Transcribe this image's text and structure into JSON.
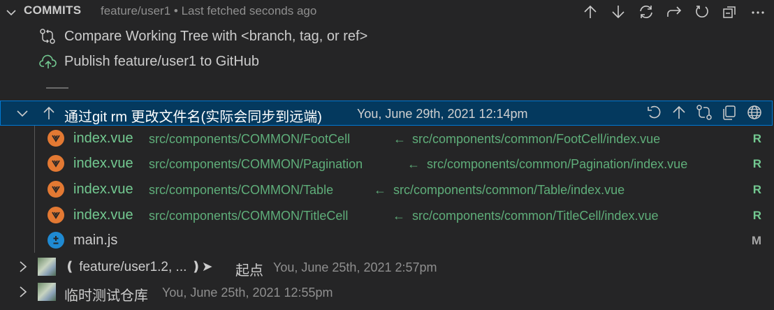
{
  "header": {
    "title": "COMMITS",
    "description": "feature/user1 • Last fetched seconds ago",
    "actions": [
      "arrow-up-icon",
      "arrow-down-icon",
      "sync-icon",
      "redo-icon",
      "refresh-icon",
      "collapse-all-icon",
      "more-icon"
    ]
  },
  "actions": {
    "compare": "Compare Working Tree with <branch, tag, or ref>",
    "publish": "Publish feature/user1 to GitHub"
  },
  "commit": {
    "message": "通过git rm 更改文件名(实际会同步到远端)",
    "meta": "You, June 29th, 2021 12:14pm",
    "actions": [
      "undo-icon",
      "arrow-up-icon",
      "compare-icon",
      "copy-icon",
      "globe-icon"
    ],
    "files": [
      {
        "name": "index.vue",
        "path": "src/components/COMMON/FootCell",
        "arrow": "←",
        "from": "src/components/common/FootCell/index.vue",
        "status": "R"
      },
      {
        "name": "index.vue",
        "path": "src/components/COMMON/Pagination",
        "arrow": "←",
        "from": "src/components/common/Pagination/index.vue",
        "status": "R"
      },
      {
        "name": "index.vue",
        "path": "src/components/COMMON/Table",
        "arrow": "←",
        "from": "src/components/common/Table/index.vue",
        "status": "R"
      },
      {
        "name": "index.vue",
        "path": "src/components/COMMON/TitleCell",
        "arrow": "←",
        "from": "src/components/common/TitleCell/index.vue",
        "status": "R"
      },
      {
        "name": "main.js",
        "status": "M"
      }
    ]
  },
  "other_commits": [
    {
      "refs": "❪ feature/user1.2, ... ❫➤",
      "message": "起点",
      "meta": "You, June 25th, 2021 2:57pm"
    },
    {
      "message": "临时测试仓库",
      "meta": "You, June 25th, 2021 12:55pm"
    }
  ],
  "colors": {
    "background": "#252526",
    "selection": "#04395e",
    "focus_border": "#0078d4",
    "renamed": "#73c991",
    "vue_badge": "#e37933",
    "js_badge": "#1f8ad2"
  }
}
